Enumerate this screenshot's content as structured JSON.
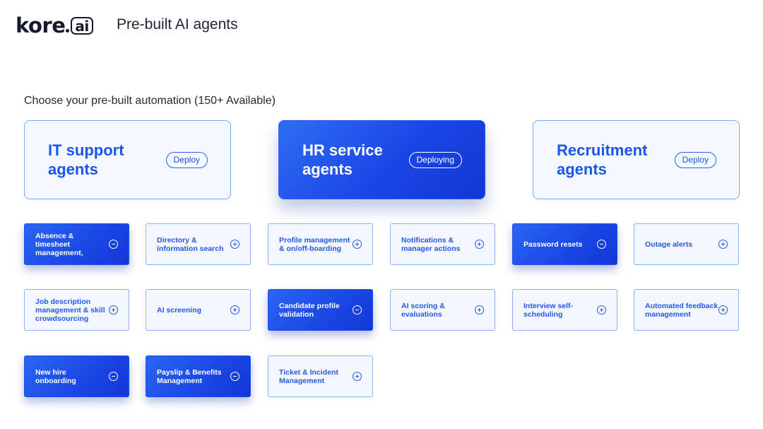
{
  "header": {
    "logo_main": "kore",
    "logo_ai": "ai",
    "title": "Pre-built AI agents"
  },
  "subtitle": "Choose your pre-built automation (150+ Available)",
  "categories": [
    {
      "title": "IT support agents",
      "button": "Deploy",
      "active": false
    },
    {
      "title": "HR service agents",
      "button": "Deploying",
      "active": true
    },
    {
      "title": "Recruitment agents",
      "button": "Deploy",
      "active": false
    }
  ],
  "tiles": [
    {
      "label": "Absence & timesheet management,",
      "state": "selected",
      "icon": "minus-circle-icon"
    },
    {
      "label": "Directory & information search",
      "state": "available",
      "icon": "plus-circle-icon"
    },
    {
      "label": "Profile management & on/off-boarding",
      "state": "available",
      "icon": "plus-circle-icon"
    },
    {
      "label": "Notifications & manager actions",
      "state": "available",
      "icon": "plus-circle-icon"
    },
    {
      "label": "Password resets",
      "state": "selected",
      "icon": "minus-circle-icon"
    },
    {
      "label": "Outage alerts",
      "state": "available",
      "icon": "plus-circle-icon"
    },
    {
      "label": "Job description management & skill crowdsourcing",
      "state": "available",
      "icon": "plus-circle-icon"
    },
    {
      "label": "AI screening",
      "state": "available",
      "icon": "plus-circle-icon"
    },
    {
      "label": "Candidate profile validation",
      "state": "selected",
      "icon": "minus-circle-icon"
    },
    {
      "label": "AI scoring & evaluations",
      "state": "available",
      "icon": "plus-circle-icon"
    },
    {
      "label": "Interview self-scheduling",
      "state": "available",
      "icon": "plus-circle-icon"
    },
    {
      "label": "Automated feedback management",
      "state": "available",
      "icon": "plus-circle-icon"
    },
    {
      "label": "New hire onboarding",
      "state": "selected",
      "icon": "minus-circle-icon"
    },
    {
      "label": "Payslip & Benefits Management",
      "state": "selected",
      "icon": "minus-circle-icon"
    },
    {
      "label": "Ticket & Incident Management",
      "state": "available",
      "icon": "plus-circle-icon"
    }
  ],
  "colors": {
    "accent": "#1b46e6",
    "accent_text": "#1b56ec",
    "tile_border": "#8cb3ee",
    "tile_bg": "#f3f7ff"
  }
}
